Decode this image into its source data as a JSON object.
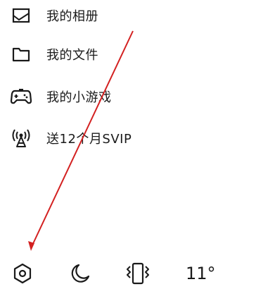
{
  "menu": {
    "items": [
      {
        "label": "我的相册",
        "icon": "photo-album-icon"
      },
      {
        "label": "我的文件",
        "icon": "folder-icon"
      },
      {
        "label": "我的小游戏",
        "icon": "gamepad-icon"
      },
      {
        "label": "送12个月SVIP",
        "icon": "broadcast-tower-icon"
      }
    ]
  },
  "bottom_bar": {
    "settings_icon": "hexagon-settings-icon",
    "night_mode_icon": "moon-icon",
    "vibration_icon": "phone-vibrate-icon",
    "weather_temp": "11°"
  },
  "colors": {
    "text": "#1a1a1a",
    "annotation_arrow": "#d32020"
  }
}
